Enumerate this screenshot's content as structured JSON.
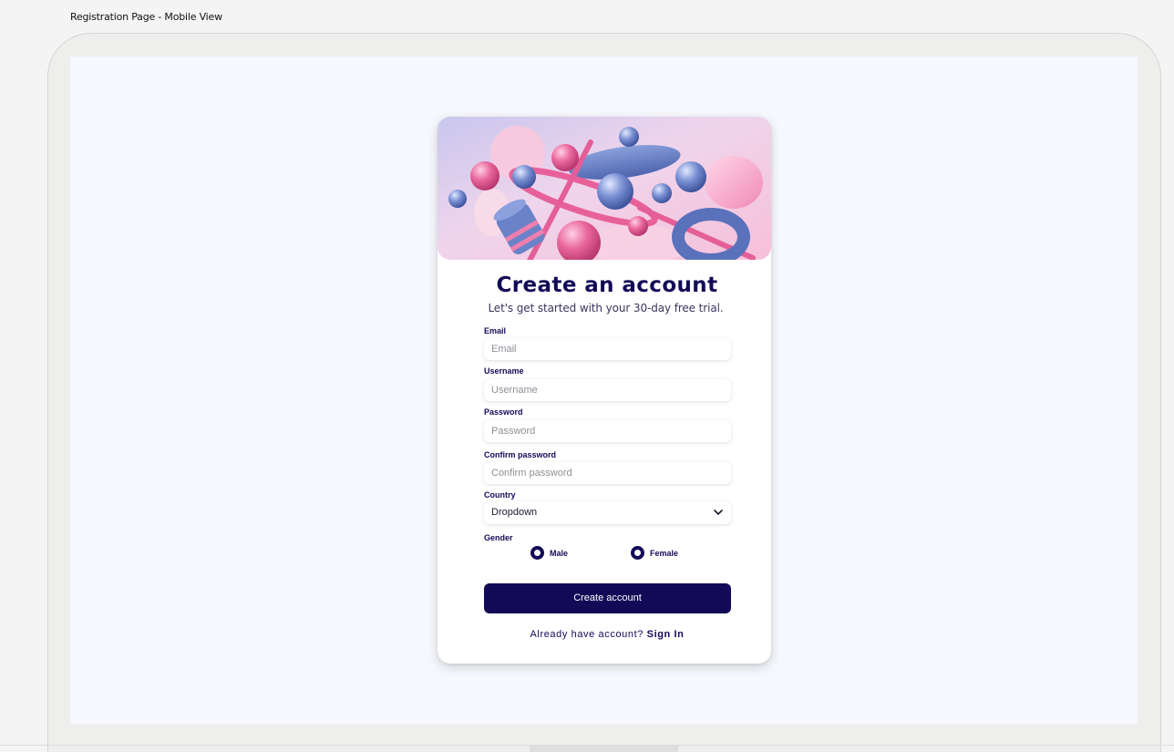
{
  "frame": {
    "title": "Registration Page - Mobile View"
  },
  "form": {
    "title": "Create an account",
    "subtitle": "Let's get started with your 30-day free trial.",
    "email": {
      "label": "Email",
      "placeholder": "Email"
    },
    "username": {
      "label": "Username",
      "placeholder": "Username"
    },
    "password": {
      "label": "Password",
      "placeholder": "Password"
    },
    "confirm_password": {
      "label": "Confirm password",
      "placeholder": "Confirm password"
    },
    "country": {
      "label": "Country",
      "value": "Dropdown"
    },
    "gender": {
      "label": "Gender",
      "options": [
        "Male",
        "Female"
      ]
    },
    "submit_label": "Create account",
    "signin_prompt": "Already have account?",
    "signin_link": "Sign In"
  },
  "colors": {
    "primary": "#130a57",
    "screen_bg": "#f6f8fd",
    "hero_pink": "#f5b8d6",
    "hero_blue": "#6d84c9"
  },
  "icons": {
    "dropdown": "chevron-down-icon",
    "hero": "abstract-3d-shapes-illustration"
  }
}
